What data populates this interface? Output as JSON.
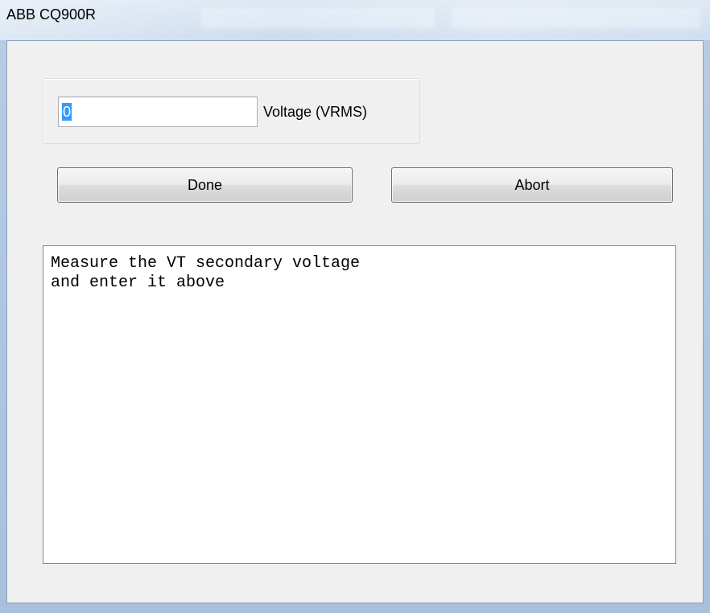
{
  "window": {
    "title": "ABB CQ900R"
  },
  "voltage": {
    "value": "0",
    "label": "Voltage (VRMS)"
  },
  "buttons": {
    "done_label": "Done",
    "abort_label": "Abort"
  },
  "message": {
    "text": "Measure the VT secondary voltage\nand enter it above"
  },
  "colors": {
    "selection_highlight": "#3399ff",
    "dialog_background": "#f0f0f0",
    "titlebar_glass": "#c9d9ec"
  }
}
